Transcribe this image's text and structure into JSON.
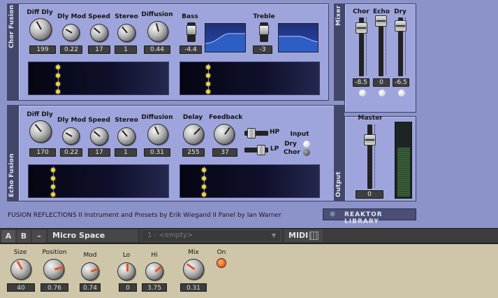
{
  "chor": {
    "side_label": "Chor Fusion",
    "knobs": [
      {
        "label": "Diff Dly",
        "value": "199"
      },
      {
        "label": "Dly Mod",
        "value": "0.22"
      },
      {
        "label": "Speed",
        "value": "17"
      },
      {
        "label": "Stereo",
        "value": "1"
      },
      {
        "label": "Diffusion",
        "value": "0.44"
      }
    ],
    "bass": {
      "label": "Bass",
      "value": "-4.4"
    },
    "treble": {
      "label": "Treble",
      "value": "-3"
    }
  },
  "echo": {
    "side_label": "Echo Fusion",
    "knobs": [
      {
        "label": "Diff Dly",
        "value": "170"
      },
      {
        "label": "Dly Mod",
        "value": "0.22"
      },
      {
        "label": "Speed",
        "value": "17"
      },
      {
        "label": "Stereo",
        "value": "1"
      },
      {
        "label": "Diffusion",
        "value": "0.31"
      },
      {
        "label": "Delay",
        "value": "255"
      },
      {
        "label": "Feedback",
        "value": "37"
      }
    ],
    "hp_label": "HP",
    "lp_label": "LP",
    "input": {
      "label": "Input",
      "dry": "Dry",
      "chor": "Chor"
    }
  },
  "mixer": {
    "side_label": "Mixer",
    "channels": [
      {
        "label": "Chor",
        "value": "-8.5"
      },
      {
        "label": "Echo",
        "value": "0"
      },
      {
        "label": "Dry",
        "value": "-6.5"
      }
    ]
  },
  "output": {
    "side_label": "Output",
    "master_label": "Master",
    "master_value": "0"
  },
  "footer": {
    "credits": "FUSION REFLECTIONS  II  Instrument and Presets by Erik Wiegand  II  Panel by Ian Warner",
    "library": "REAKTOR LIBRARY"
  },
  "toolbar": {
    "tab_a": "A",
    "tab_b": "B",
    "minus": "–",
    "preset_name": "Micro Space",
    "snapshot_placeholder": "1 - <empty>",
    "midi": "MIDI"
  },
  "macro": {
    "knobs": [
      {
        "label": "Size",
        "value": "40"
      },
      {
        "label": "Position",
        "value": "0.76"
      },
      {
        "label": "Mod",
        "value": "0.74"
      },
      {
        "label": "Lo",
        "value": "0"
      },
      {
        "label": "Hi",
        "value": "3.75"
      },
      {
        "label": "Mix",
        "value": "0.31"
      }
    ],
    "on_label": "On"
  },
  "colors": {
    "panel": "#9ea5dc",
    "frame": "#424669",
    "display_line": "#5b8ee0",
    "display_dot": "#f0d440",
    "bottom_bg": "#cfc6aa",
    "knob_indicator": "#e55420"
  }
}
